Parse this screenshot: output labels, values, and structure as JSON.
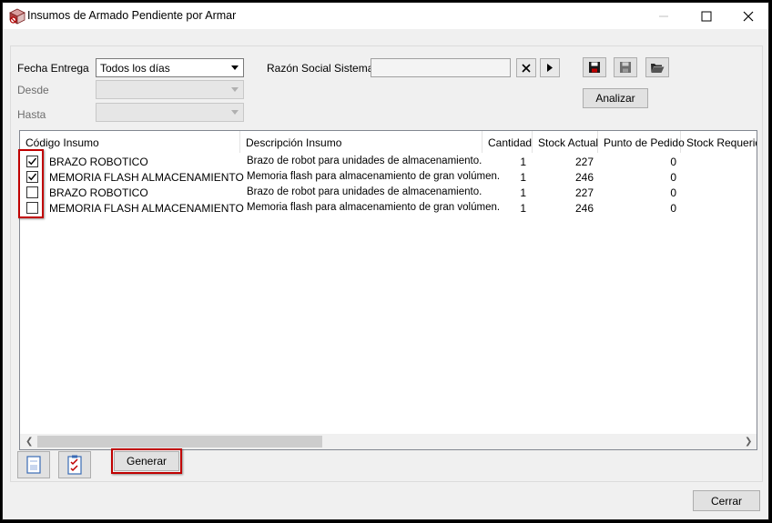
{
  "window": {
    "title": "Insumos de Armado Pendiente por Armar"
  },
  "filters": {
    "fecha_entrega_label": "Fecha Entrega",
    "fecha_entrega_value": "Todos los días",
    "desde_label": "Desde",
    "hasta_label": "Hasta",
    "razon_social_label": "Razón Social Sistema",
    "razon_social_value": ""
  },
  "buttons": {
    "analizar": "Analizar",
    "generar": "Generar",
    "cerrar": "Cerrar"
  },
  "grid": {
    "columns": [
      "Código Insumo",
      "Descripción Insumo",
      "Cantidad",
      "Stock Actual",
      "Punto de Pedido",
      "Stock Requerido"
    ],
    "rows": [
      {
        "checked": true,
        "codigo": "BRAZO ROBOTICO",
        "descripcion": "Brazo de robot para unidades de almacenamiento.",
        "cantidad": "1",
        "stock_actual": "227",
        "punto_pedido": "0"
      },
      {
        "checked": true,
        "codigo": "MEMORIA FLASH ALMACENAMIENTO",
        "descripcion": "Memoria flash para almacenamiento de gran volúmen.",
        "cantidad": "1",
        "stock_actual": "246",
        "punto_pedido": "0"
      },
      {
        "checked": false,
        "codigo": "BRAZO ROBOTICO",
        "descripcion": "Brazo de robot para unidades de almacenamiento.",
        "cantidad": "1",
        "stock_actual": "227",
        "punto_pedido": "0"
      },
      {
        "checked": false,
        "codigo": "MEMORIA FLASH ALMACENAMIENTO",
        "descripcion": "Memoria flash para almacenamiento de gran volúmen.",
        "cantidad": "1",
        "stock_actual": "246",
        "punto_pedido": "0"
      }
    ]
  },
  "colors": {
    "highlight": "#c00000",
    "window_bg": "#f0f0f0"
  },
  "icons": {
    "app": "package-icon",
    "save": "save-icon",
    "save_disabled": "save-icon",
    "open": "folder-open-icon",
    "clear": "close-icon",
    "next": "play-icon",
    "select_none": "blank-document-icon",
    "select_all": "checklist-icon"
  }
}
